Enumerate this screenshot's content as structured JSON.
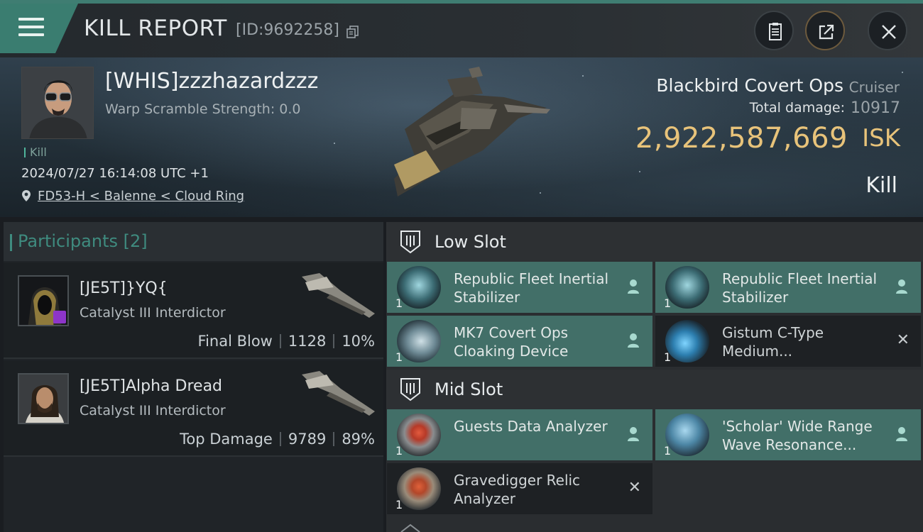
{
  "header": {
    "title": "KILL REPORT",
    "report_id": "[ID:9692258]",
    "icons": [
      "menu-icon",
      "copy-icon",
      "clipboard-icon",
      "share-icon",
      "close-icon"
    ]
  },
  "victim": {
    "name": "[WHIS]zzzhazardzzz",
    "warp_scramble": "Warp Scramble Strength: 0.0",
    "tag": "Kill",
    "datetime": "2024/07/27 16:14:08 UTC +1",
    "location": "FD53-H < Balenne < Cloud Ring",
    "ship_name": "Blackbird Covert Ops",
    "ship_class": "Cruiser",
    "total_damage_label": "Total damage:",
    "total_damage": "10917",
    "isk_value": "2,922,587,669",
    "isk_unit": "ISK",
    "kill_type": "Kill"
  },
  "participants": {
    "title": "Participants [2]",
    "items": [
      {
        "name": "[JE5T]}YQ{",
        "ship": "Catalyst III Interdictor",
        "role": "Final Blow",
        "damage": "1128",
        "percent": "10%"
      },
      {
        "name": "[JE5T]Alpha Dread",
        "ship": "Catalyst III Interdictor",
        "role": "Top Damage",
        "damage": "9789",
        "percent": "89%"
      }
    ]
  },
  "slots": {
    "low": {
      "title": "Low Slot",
      "modules": [
        {
          "name": "Republic Fleet Inertial Stabilizer",
          "qty": "1",
          "status": "destroyed"
        },
        {
          "name": "Republic Fleet Inertial Stabilizer",
          "qty": "1",
          "status": "destroyed"
        },
        {
          "name": "MK7 Covert Ops Cloaking Device",
          "qty": "1",
          "status": "destroyed"
        },
        {
          "name": "Gistum C-Type Medium...",
          "qty": "1",
          "status": "dropped"
        }
      ]
    },
    "mid": {
      "title": "Mid Slot",
      "modules": [
        {
          "name": "Guests Data Analyzer",
          "qty": "1",
          "status": "destroyed"
        },
        {
          "name": "'Scholar' Wide Range Wave Resonance...",
          "qty": "1",
          "status": "destroyed"
        },
        {
          "name": "Gravedigger Relic Analyzer",
          "qty": "1",
          "status": "dropped"
        }
      ]
    }
  },
  "colors": {
    "accent": "#3a7d70",
    "isk": "#e8c37a",
    "owned_module_bg": "#426f68",
    "dropped_module_bg": "#1e2124"
  }
}
